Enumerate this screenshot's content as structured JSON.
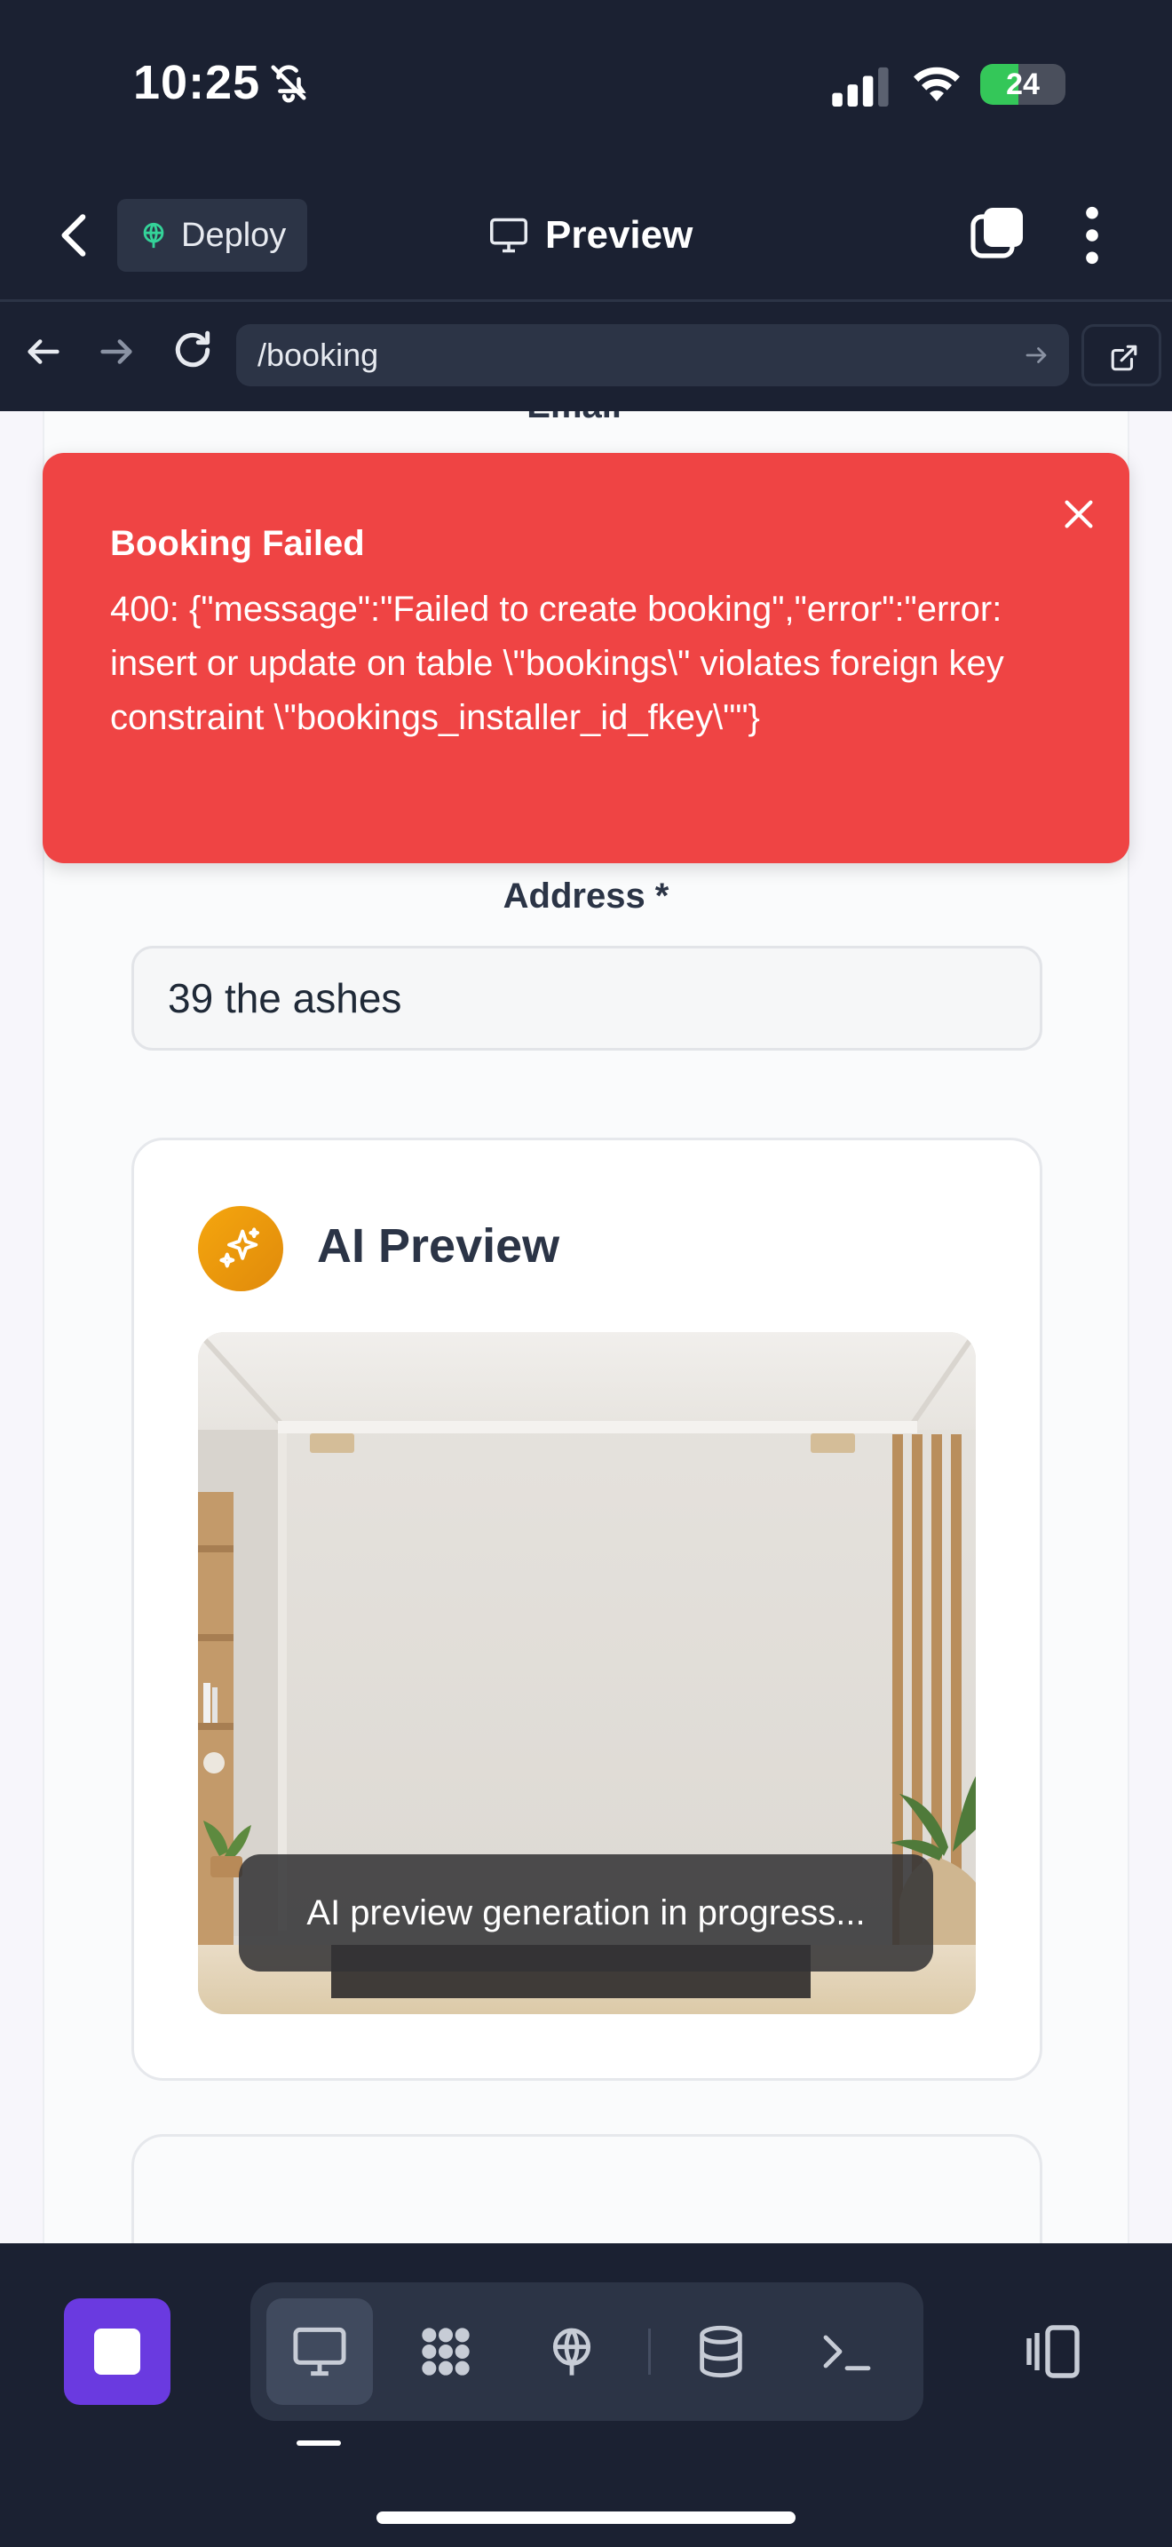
{
  "status_bar": {
    "time": "10:25",
    "battery": "24",
    "battery_level": 0.24,
    "icons": [
      "bell-slash-icon",
      "signal-icon",
      "wifi-icon",
      "battery-charging-icon"
    ]
  },
  "top_bar": {
    "deploy_label": "Deploy",
    "title": "Preview",
    "icons": [
      "chevron-left-icon",
      "globe-icon",
      "monitor-icon",
      "tabs-icon",
      "more-vertical-icon"
    ]
  },
  "url_bar": {
    "url": "/booking",
    "icons": [
      "arrow-left-icon",
      "arrow-right-icon",
      "reload-icon",
      "arrow-right-icon",
      "external-link-icon"
    ]
  },
  "form": {
    "email_label": "Email *",
    "address_label": "Address *",
    "address_value": "39 the ashes"
  },
  "ai_preview": {
    "title": "AI Preview",
    "status": "AI preview generation in progress...",
    "icons": [
      "sparkles-icon"
    ]
  },
  "error_toast": {
    "title": "Booking Failed",
    "message": "400: {\"message\":\"Failed to create booking\",\"error\":\"error: insert or update on table \\\"bookings\\\" violates foreign key constraint \\\"bookings_installer_id_fkey\\\"\"}",
    "icons": [
      "close-icon"
    ]
  },
  "bottom_bar": {
    "icons": [
      "stop-icon",
      "monitor-icon",
      "integrations-icon",
      "deploy-icon",
      "database-icon",
      "terminal-icon",
      "panel-toggle-icon"
    ],
    "active_tool": "monitor",
    "colors": {
      "accent": "#6a3ae0",
      "background": "#1b2132",
      "error": "#ef4444"
    }
  }
}
